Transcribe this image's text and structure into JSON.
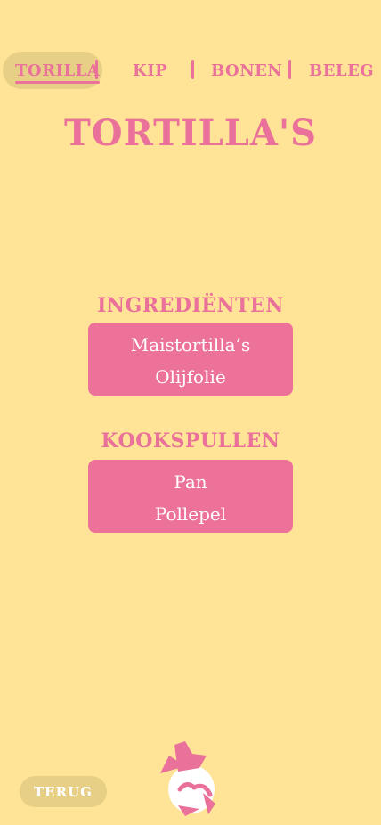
{
  "nav": {
    "tabs": [
      {
        "label": "TORILLA"
      },
      {
        "label": "KIP"
      },
      {
        "label": "BONEN"
      },
      {
        "label": "BELEG"
      }
    ],
    "active_tab": "TORILLA"
  },
  "page": {
    "title": "TORTILLA'S"
  },
  "ingredients": {
    "title": "INGREDIËNTEN",
    "items": [
      "Maistortilla’s",
      "Olijfolie"
    ]
  },
  "tools": {
    "title": "KOOKSPULLEN",
    "items": [
      "Pan",
      "Pollepel"
    ]
  },
  "footer": {
    "back_label": "TERUG"
  },
  "icons": {
    "mascot": "chef-mascot-icon"
  },
  "colors": {
    "background": "#FFE497",
    "accent_pink": "#E9719A",
    "card_pink": "#EC729A",
    "pill": "#E8CF86",
    "text_on_card": "#FFFFFF"
  }
}
